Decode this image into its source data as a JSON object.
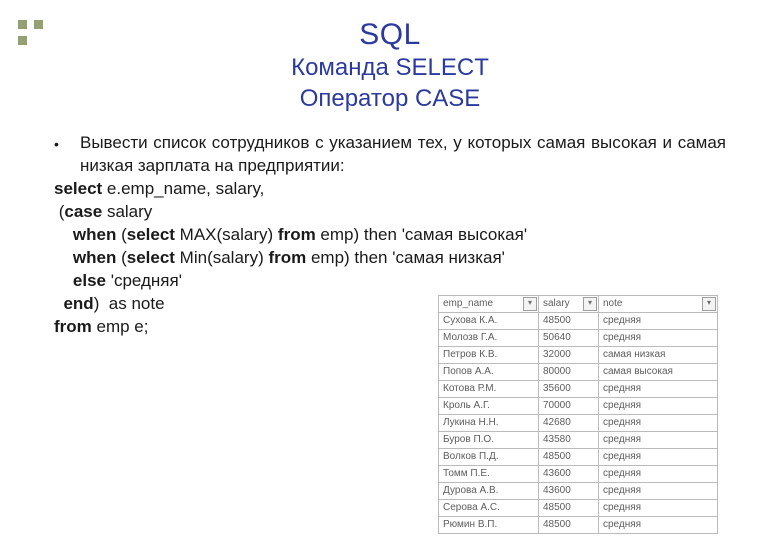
{
  "title": "SQL",
  "subtitle1": "Команда SELECT",
  "subtitle2": "Оператор CASE",
  "bullet_text": "Вывести список сотрудников с указанием тех, у которых самая высокая и самая низкая зарплата на предприятии:",
  "code": {
    "l1a": "select",
    "l1b": " e.emp_name, salary,",
    "l2a": " (",
    "l2b": "case",
    "l2c": " salary",
    "l3a": "    ",
    "l3b": "when",
    "l3c": " (",
    "l3d": "select",
    "l3e": " MAX(salary) ",
    "l3f": "from",
    "l3g": " emp) then 'самая высокая'",
    "l4a": "    ",
    "l4b": "when",
    "l4c": " (",
    "l4d": "select",
    "l4e": " Min(salary) ",
    "l4f": "from",
    "l4g": " emp) then 'самая низкая'",
    "l5a": "    ",
    "l5b": "else",
    "l5c": " 'средняя'",
    "l6a": "  ",
    "l6b": "end",
    "l6c": ")  as note",
    "l7a": "from",
    "l7b": " emp e;"
  },
  "table": {
    "headers": [
      "emp_name",
      "salary",
      "note"
    ],
    "rows": [
      {
        "name": "Сухова К.А.",
        "salary": "48500",
        "note": "средняя"
      },
      {
        "name": "Молозв Г.А.",
        "salary": "50640",
        "note": "средняя"
      },
      {
        "name": "Петров К.В.",
        "salary": "32000",
        "note": "самая низкая"
      },
      {
        "name": "Попов А.А.",
        "salary": "80000",
        "note": "самая высокая"
      },
      {
        "name": "Котова Р.М.",
        "salary": "35600",
        "note": "средняя"
      },
      {
        "name": "Кроль А.Г.",
        "salary": "70000",
        "note": "средняя"
      },
      {
        "name": "Лукина Н.Н.",
        "salary": "42680",
        "note": "средняя"
      },
      {
        "name": "Буров П.О.",
        "salary": "43580",
        "note": "средняя"
      },
      {
        "name": "Волков П.Д.",
        "salary": "48500",
        "note": "средняя"
      },
      {
        "name": "Томм П.Е.",
        "salary": "43600",
        "note": "средняя"
      },
      {
        "name": "Дурова А.В.",
        "salary": "43600",
        "note": "средняя"
      },
      {
        "name": "Серова А.С.",
        "salary": "48500",
        "note": "средняя"
      },
      {
        "name": "Рюмин В.П.",
        "salary": "48500",
        "note": "средняя"
      }
    ]
  }
}
